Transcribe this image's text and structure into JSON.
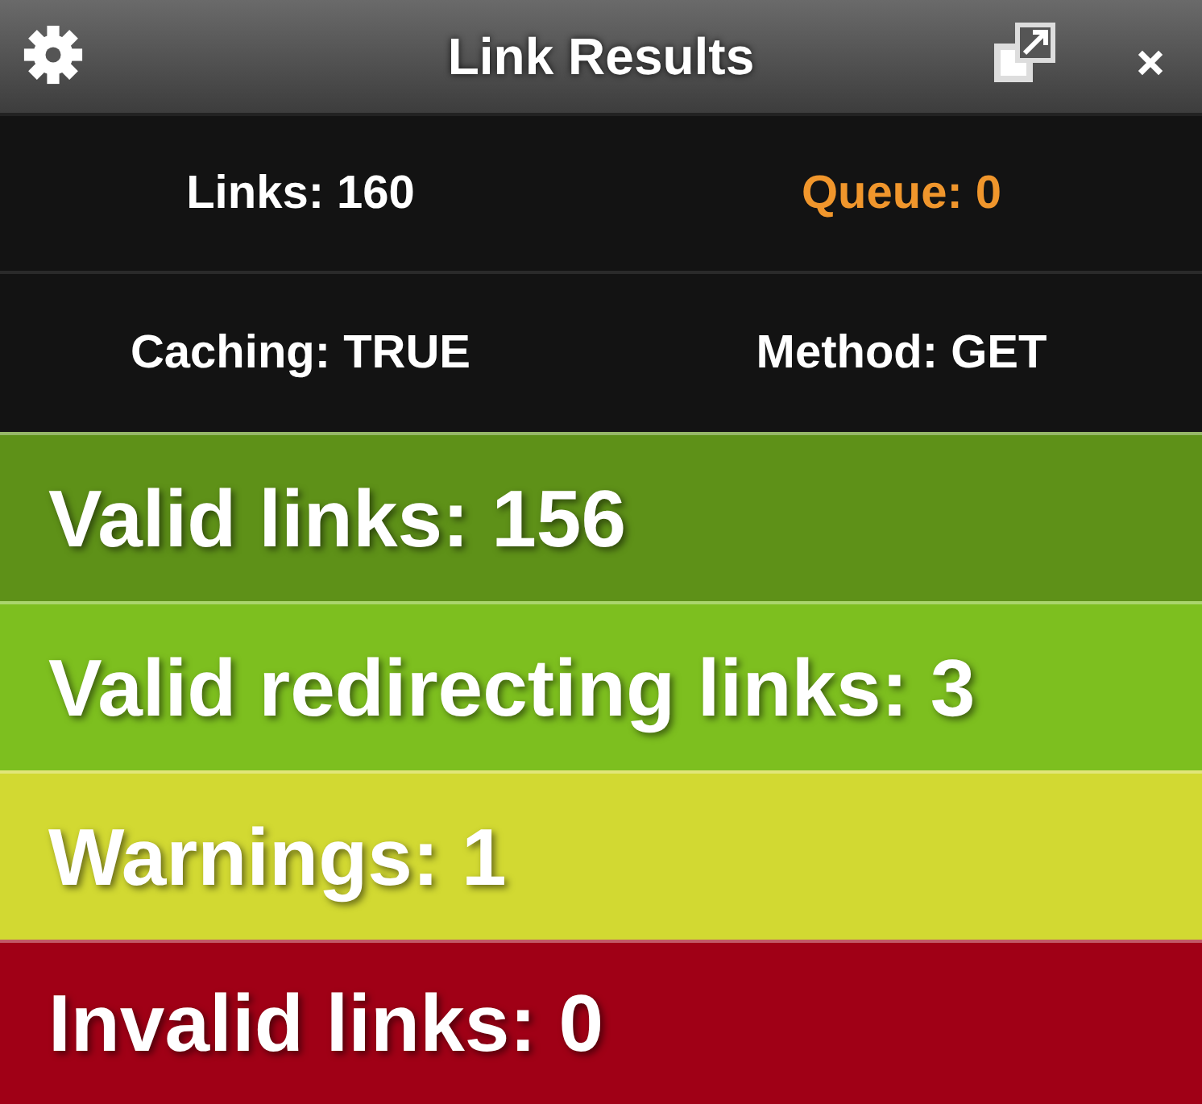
{
  "window": {
    "title": "Link Results"
  },
  "stats": [
    [
      {
        "text": "Links: 160",
        "color": "#ffffff"
      },
      {
        "text": "Queue: 0",
        "color": "#f0962c"
      }
    ],
    [
      {
        "text": "Caching: TRUE",
        "color": "#ffffff"
      },
      {
        "text": "Method: GET",
        "color": "#ffffff"
      }
    ]
  ],
  "results": [
    {
      "text": "Valid links: 156",
      "color": "#5e9118"
    },
    {
      "text": "Valid redirecting links: 3",
      "color": "#7dbf1f"
    },
    {
      "text": "Warnings: 1",
      "color": "#d2d932"
    },
    {
      "text": "Invalid links: 0",
      "color": "#a00016"
    }
  ]
}
